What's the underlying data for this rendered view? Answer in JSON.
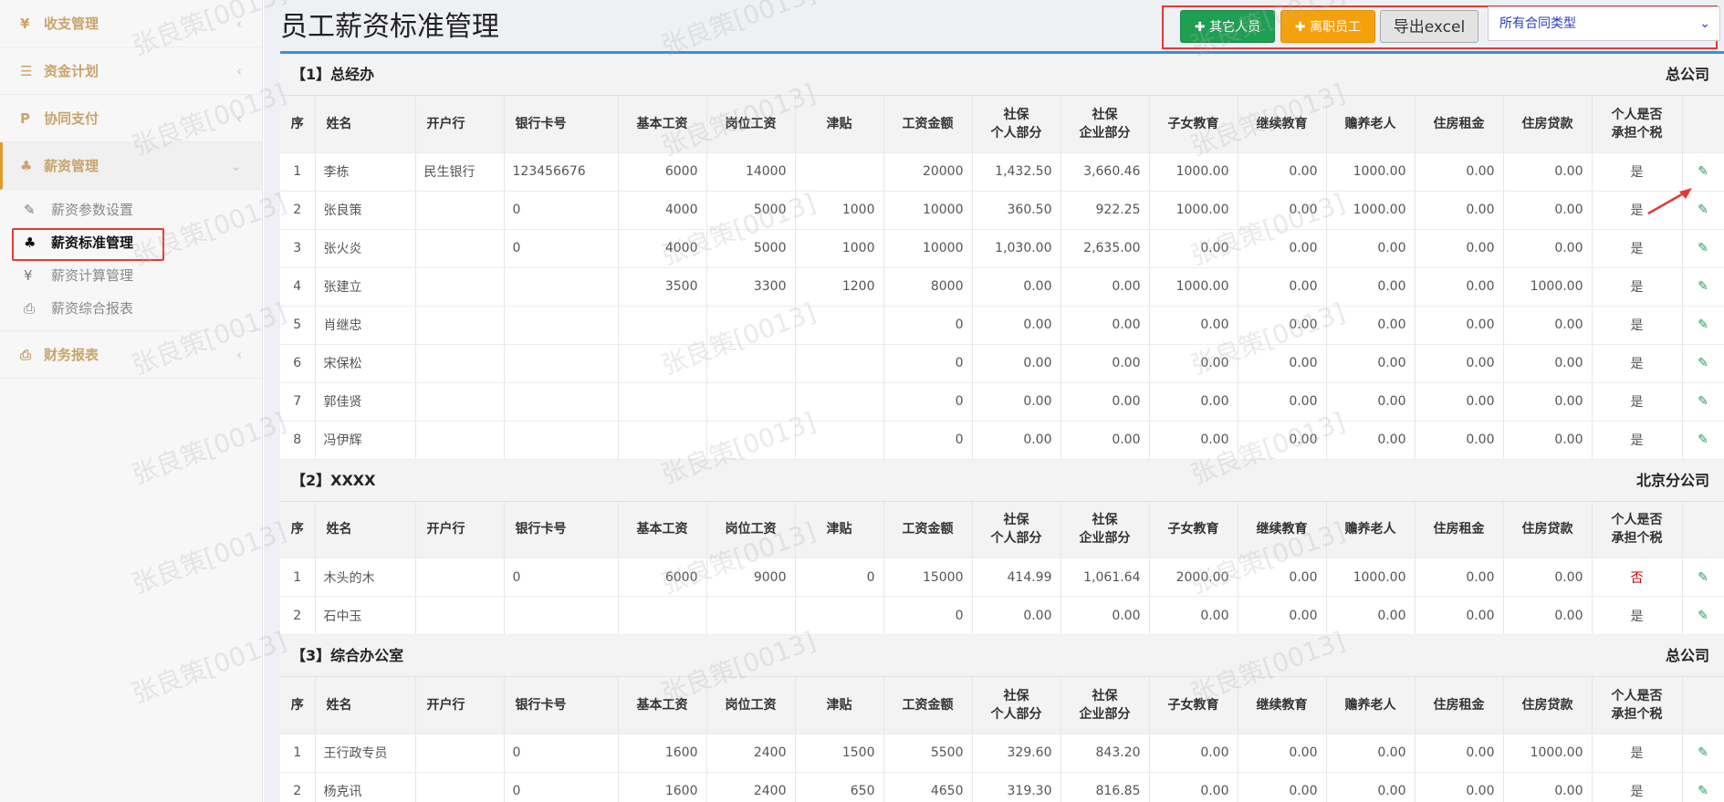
{
  "sidebar": {
    "items": [
      {
        "icon": "yen-icon",
        "glyph": "¥",
        "label": "收支管理"
      },
      {
        "icon": "list-icon",
        "glyph": "☰",
        "label": "资金计划"
      },
      {
        "icon": "paypal-icon",
        "glyph": "P",
        "label": "协同支付"
      },
      {
        "icon": "users-icon",
        "glyph": "♣",
        "label": "薪资管理"
      },
      {
        "icon": "print-icon",
        "glyph": "⎙",
        "label": "财务报表"
      }
    ],
    "submenu": [
      {
        "icon": "edit-icon",
        "glyph": "✎",
        "label": "薪资参数设置"
      },
      {
        "icon": "users-icon",
        "glyph": "♣",
        "label": "薪资标准管理"
      },
      {
        "icon": "yen-icon",
        "glyph": "¥",
        "label": "薪资计算管理"
      },
      {
        "icon": "print-icon",
        "glyph": "⎙",
        "label": "薪资综合报表"
      }
    ]
  },
  "page": {
    "title": "员工薪资标准管理"
  },
  "toolbar": {
    "other_label": "其它人员",
    "resigned_label": "离职员工",
    "export_label": "导出excel",
    "contract_type": "所有合同类型"
  },
  "columns": [
    "序",
    "姓名",
    "开户行",
    "银行卡号",
    "基本工资",
    "岗位工资",
    "津贴",
    "工资金额",
    "社保个人部分",
    "社保企业部分",
    "子女教育",
    "继续教育",
    "赡养老人",
    "住房租金",
    "住房贷款",
    "个人是否承担个税"
  ],
  "columns_display": [
    "序",
    "姓名",
    "开户行",
    "银行卡号",
    "基本工资",
    "岗位工资",
    "津贴",
    "工资金额",
    "社保\n个人部分",
    "社保\n企业部分",
    "子女教育",
    "继续教育",
    "赡养老人",
    "住房租金",
    "住房贷款",
    "个人是否\n承担个税"
  ],
  "sections": [
    {
      "title": "【1】总经办",
      "company": "总公司",
      "rows": [
        [
          "1",
          "李栋",
          "民生银行",
          "123456676",
          "6000",
          "14000",
          "",
          "20000",
          "1,432.50",
          "3,660.46",
          "1000.00",
          "0.00",
          "1000.00",
          "0.00",
          "0.00",
          "是"
        ],
        [
          "2",
          "张良策",
          "",
          "0",
          "4000",
          "5000",
          "1000",
          "10000",
          "360.50",
          "922.25",
          "1000.00",
          "0.00",
          "1000.00",
          "0.00",
          "0.00",
          "是"
        ],
        [
          "3",
          "张火炎",
          "",
          "0",
          "4000",
          "5000",
          "1000",
          "10000",
          "1,030.00",
          "2,635.00",
          "0.00",
          "0.00",
          "0.00",
          "0.00",
          "0.00",
          "是"
        ],
        [
          "4",
          "张建立",
          "",
          "",
          "3500",
          "3300",
          "1200",
          "8000",
          "0.00",
          "0.00",
          "1000.00",
          "0.00",
          "0.00",
          "0.00",
          "1000.00",
          "是"
        ],
        [
          "5",
          "肖继忠",
          "",
          "",
          "",
          "",
          "",
          "0",
          "0.00",
          "0.00",
          "0.00",
          "0.00",
          "0.00",
          "0.00",
          "0.00",
          "是"
        ],
        [
          "6",
          "宋保松",
          "",
          "",
          "",
          "",
          "",
          "0",
          "0.00",
          "0.00",
          "0.00",
          "0.00",
          "0.00",
          "0.00",
          "0.00",
          "是"
        ],
        [
          "7",
          "郭佳贤",
          "",
          "",
          "",
          "",
          "",
          "0",
          "0.00",
          "0.00",
          "0.00",
          "0.00",
          "0.00",
          "0.00",
          "0.00",
          "是"
        ],
        [
          "8",
          "冯伊辉",
          "",
          "",
          "",
          "",
          "",
          "0",
          "0.00",
          "0.00",
          "0.00",
          "0.00",
          "0.00",
          "0.00",
          "0.00",
          "是"
        ]
      ]
    },
    {
      "title": "【2】XXXX",
      "company": "北京分公司",
      "rows": [
        [
          "1",
          "木头的木",
          "",
          "0",
          "6000",
          "9000",
          "0",
          "15000",
          "414.99",
          "1,061.64",
          "2000.00",
          "0.00",
          "1000.00",
          "0.00",
          "0.00",
          "否"
        ],
        [
          "2",
          "石中玉",
          "",
          "",
          "",
          "",
          "",
          "0",
          "0.00",
          "0.00",
          "0.00",
          "0.00",
          "0.00",
          "0.00",
          "0.00",
          "是"
        ]
      ]
    },
    {
      "title": "【3】综合办公室",
      "company": "总公司",
      "rows": [
        [
          "1",
          "王行政专员",
          "",
          "0",
          "1600",
          "2400",
          "1500",
          "5500",
          "329.60",
          "843.20",
          "0.00",
          "0.00",
          "0.00",
          "0.00",
          "1000.00",
          "是"
        ],
        [
          "2",
          "杨克讯",
          "",
          "0",
          "1600",
          "2400",
          "650",
          "4650",
          "319.30",
          "816.85",
          "0.00",
          "0.00",
          "0.00",
          "0.00",
          "0.00",
          "是"
        ]
      ]
    }
  ],
  "watermark": "张良策[0013]",
  "colors": {
    "accent": "#3d8ed9",
    "green": "#1e9f52",
    "orange": "#f5a00d",
    "menu_gold": "#c9a46b",
    "highlight": "#e53935"
  }
}
